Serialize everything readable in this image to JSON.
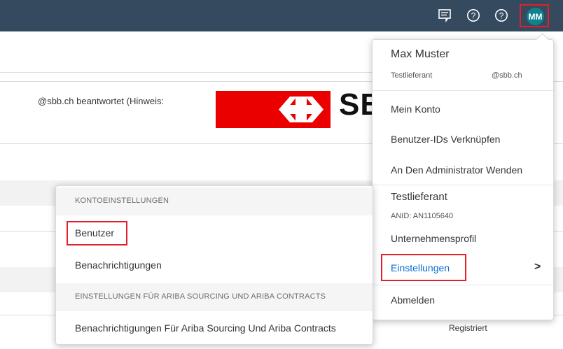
{
  "topbar": {
    "avatar_initials": "MM",
    "icons": [
      "feedback-icon",
      "help-icon",
      "help-icon"
    ]
  },
  "background": {
    "email_text": "@sbb.ch beantwortet (Hinweis:",
    "logo_text": "SBB",
    "status_text": "Registriert"
  },
  "user_menu": {
    "name": "Max Muster",
    "company": "Testlieferant",
    "email": "@sbb.ch",
    "items": [
      "Mein Konto",
      "Benutzer-IDs Verknüpfen",
      "An Den Administrator Wenden"
    ],
    "org_name": "Testlieferant",
    "anid": "ANID: AN1105640",
    "company_profile": "Unternehmensprofil",
    "settings": "Einstellungen",
    "settings_chevron": ">",
    "logout": "Abmelden"
  },
  "settings_menu": {
    "section1_header": "KONTOEINSTELLUNGEN",
    "users": "Benutzer",
    "notifications": "Benachrichtigungen",
    "section2_header": "EINSTELLUNGEN FÜR ARIBA SOURCING UND ARIBA CONTRACTS",
    "sourcing_notifications": "Benachrichtigungen Für Ariba Sourcing Und Ariba Contracts"
  },
  "colors": {
    "topbar": "#354a5f",
    "avatar": "#0f828f",
    "highlight": "#e0202a",
    "link": "#0a6ed1",
    "sbb_red": "#eb0000"
  }
}
